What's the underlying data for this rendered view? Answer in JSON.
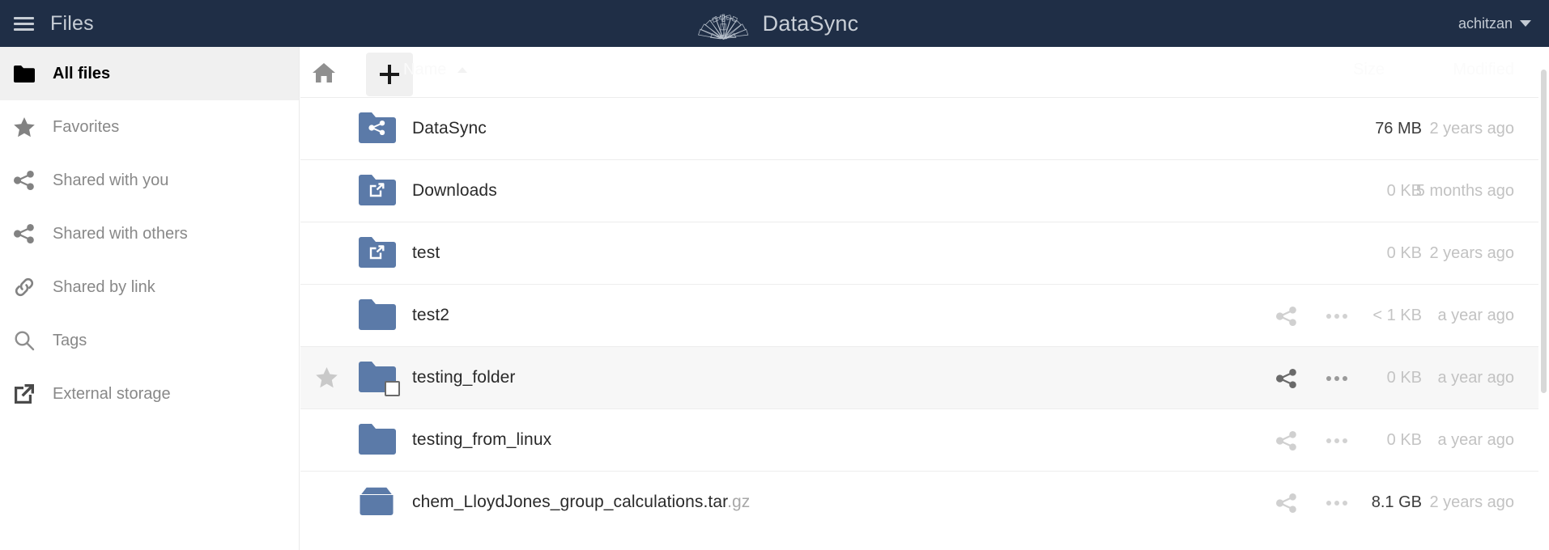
{
  "header": {
    "menu_icon": "hamburger-icon",
    "app_title": "Files",
    "brand_logo_icon": "datasync-fan-logo",
    "brand_name": "DataSync",
    "username": "achitzan",
    "caret_icon": "chevron-down-icon",
    "background_color": "#1f2e46",
    "text_color": "#c7cdd5"
  },
  "sidebar": {
    "items": [
      {
        "label": "All files",
        "icon": "folder-icon",
        "active": true
      },
      {
        "label": "Favorites",
        "icon": "star-icon",
        "active": false
      },
      {
        "label": "Shared with you",
        "icon": "share-icon",
        "active": false
      },
      {
        "label": "Shared with others",
        "icon": "share-icon",
        "active": false
      },
      {
        "label": "Shared by link",
        "icon": "link-icon",
        "active": false
      },
      {
        "label": "Tags",
        "icon": "search-icon",
        "active": false
      },
      {
        "label": "External storage",
        "icon": "external-link-icon",
        "active": false
      }
    ]
  },
  "toolbar": {
    "home_icon": "home-icon",
    "new_button_icon": "plus-icon",
    "new_button_label": "+"
  },
  "columns": {
    "name": "Name",
    "name_sort_icon": "sort-ascending-caret",
    "size": "Size",
    "modified": "Modified"
  },
  "files": [
    {
      "name": "DataSync",
      "ext": "",
      "icon": "folder-shared-icon",
      "size": "76 MB",
      "size_emphasis": true,
      "modified": "2 years ago",
      "favorited": false,
      "hovered": false,
      "show_actions": false
    },
    {
      "name": "Downloads",
      "ext": "",
      "icon": "folder-external-icon",
      "size": "0 KB",
      "size_emphasis": false,
      "modified": "5 months ago",
      "favorited": false,
      "hovered": false,
      "show_actions": false
    },
    {
      "name": "test",
      "ext": "",
      "icon": "folder-external-icon",
      "size": "0 KB",
      "size_emphasis": false,
      "modified": "2 years ago",
      "favorited": false,
      "hovered": false,
      "show_actions": false
    },
    {
      "name": "test2",
      "ext": "",
      "icon": "folder-icon",
      "size": "< 1 KB",
      "size_emphasis": false,
      "modified": "a year ago",
      "favorited": false,
      "hovered": false,
      "show_actions": true
    },
    {
      "name": "testing_folder",
      "ext": "",
      "icon": "folder-icon",
      "size": "0 KB",
      "size_emphasis": false,
      "modified": "a year ago",
      "favorited": true,
      "hovered": true,
      "show_actions": true
    },
    {
      "name": "testing_from_linux",
      "ext": "",
      "icon": "folder-icon",
      "size": "0 KB",
      "size_emphasis": false,
      "modified": "a year ago",
      "favorited": false,
      "hovered": false,
      "show_actions": true
    },
    {
      "name": "chem_LloydJones_group_calculations.tar",
      "ext": ".gz",
      "icon": "archive-icon",
      "size": "8.1 GB",
      "size_emphasis": true,
      "modified": "2 years ago",
      "favorited": false,
      "hovered": false,
      "show_actions": true
    }
  ],
  "row_actions": {
    "share_icon": "share-icon",
    "more_icon": "more-actions-icon"
  },
  "colors": {
    "header_bg": "#1f2e46",
    "folder_blue": "#5b7aa8",
    "sidebar_active_bg": "#f0f0f0",
    "row_hover_bg": "#f7f7f7"
  }
}
